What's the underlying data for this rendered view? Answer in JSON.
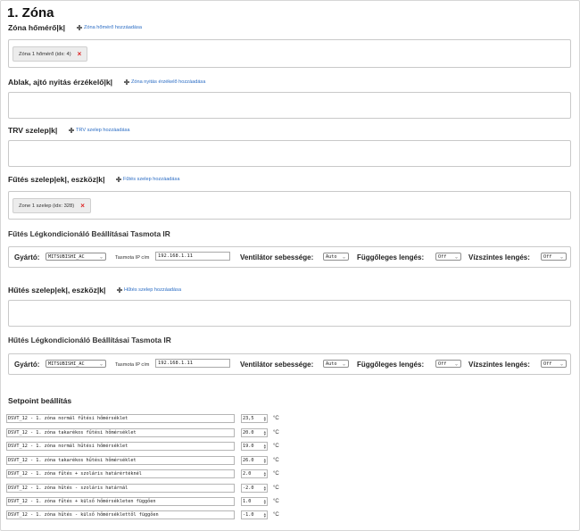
{
  "zone": {
    "title": "1. Zóna"
  },
  "sections": {
    "thermometers": {
      "heading": "Zóna hőmérő|k|",
      "add_label": "Zóna hőmérő hozzáadása",
      "chips": [
        {
          "label": "Zóna 1 hőmérő (idx: 4)"
        }
      ]
    },
    "window_sensors": {
      "heading": "Ablak, ajtó nyitás érzékelő|k|",
      "add_label": "Zóna nyitás érzékelő hozzáadása",
      "chips": []
    },
    "trv_valves": {
      "heading": "TRV szelep|k|",
      "add_label": "TRV szelep hozzáadása",
      "chips": []
    },
    "heating_valves": {
      "heading": "Fűtés szelep|ek|, eszköz|k|",
      "add_label": "Fűtés szelep hozzáadása",
      "chips": [
        {
          "label": "Zone 1 szelep (idx: 328)"
        }
      ]
    },
    "cooling_valves": {
      "heading": "Hűtés szelep|ek|, eszköz|k|",
      "add_label": "Hűtés szelep hozzáadása",
      "chips": []
    }
  },
  "ac_heating": {
    "heading": "Fűtés Légkondicionáló Beállításai Tasmota IR",
    "maker_label": "Gyártó:",
    "maker_value": "MITSUBISHI_AC",
    "ip_label": "Tasmota IP cím",
    "ip_value": "192.168.1.11",
    "fan_label": "Ventilátor sebessége:",
    "fan_value": "Auto",
    "vswing_label": "Függőleges lengés:",
    "vswing_value": "Off",
    "hswing_label": "Vízszintes lengés:",
    "hswing_value": "Off"
  },
  "ac_cooling": {
    "heading": "Hűtés Légkondicionáló Beállításai Tasmota IR",
    "maker_label": "Gyártó:",
    "maker_value": "MITSUBISHI_AC",
    "ip_label": "Tasmota IP cím",
    "ip_value": "192.168.1.11",
    "fan_label": "Ventilátor sebessége:",
    "fan_value": "Auto",
    "vswing_label": "Függőleges lengés:",
    "vswing_value": "Off",
    "hswing_label": "Vízszintes lengés:",
    "hswing_value": "Off"
  },
  "setpoints": {
    "heading": "Setpoint beállítás",
    "unit": "°C",
    "rows": [
      {
        "name": "DSVT_12 - 1. zóna normál fűtési hőmérséklet",
        "value": "23,5"
      },
      {
        "name": "DSVT_12 - 1. zóna takarékos fűtési hőmérséklet",
        "value": "20.0"
      },
      {
        "name": "DSVT_12 - 1. zóna normál hűtési hőmérséklet",
        "value": "19.0"
      },
      {
        "name": "DSVT_12 - 1. zóna takarékos hűtési hőmérséklet",
        "value": "26.0"
      },
      {
        "name": "DSVT_12 - 1. zóna fűtés + szoláris határértéknél",
        "value": "2.0"
      },
      {
        "name": "DSVT_12 - 1. zóna hűtés - szoláris határnál",
        "value": "-2.0"
      },
      {
        "name": "DSVT_12 - 1. zóna fűtés + külső hőmérsékleten függően",
        "value": "1.0"
      },
      {
        "name": "DSVT_12 - 1. zóna hűtés - külső hőmérséklettől függően",
        "value": "-1.0"
      }
    ]
  }
}
